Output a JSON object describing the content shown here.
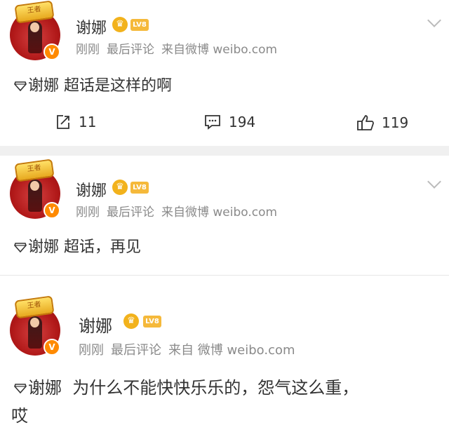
{
  "posts": [
    {
      "user": "谢娜",
      "crown_text": "王者",
      "lv": "LV8",
      "meta": {
        "time": "刚刚",
        "sort": "最后评论",
        "source": "来自微博 weibo.com"
      },
      "tag": "谢娜",
      "text": "超话是这样的啊",
      "actions": {
        "repost": "11",
        "comment": "194",
        "like": "119"
      }
    },
    {
      "user": "谢娜",
      "crown_text": "王者",
      "lv": "LV8",
      "meta": {
        "time": "刚刚",
        "sort": "最后评论",
        "source": "来自微博 weibo.com"
      },
      "tag": "谢娜",
      "text": "超话，再见"
    },
    {
      "user": "谢娜",
      "crown_text": "王者",
      "lv": "LV8",
      "meta": {
        "time": "刚刚",
        "sort": "最后评论",
        "source": "来自 微博 weibo.com"
      },
      "tag": "谢娜",
      "text_line1": "为什么不能快快乐乐的，怨气这么重，",
      "text_line2": "哎"
    }
  ],
  "colors": {
    "badge": "#ff8a00",
    "lv": "#f5b93b",
    "meta": "#8a8a8a",
    "separator": "#f0f0f0"
  },
  "icons": [
    "repost-icon",
    "comment-icon",
    "like-icon",
    "chevron-down-icon",
    "super-topic-diamond-icon",
    "verified-v-icon",
    "crown-icon"
  ]
}
